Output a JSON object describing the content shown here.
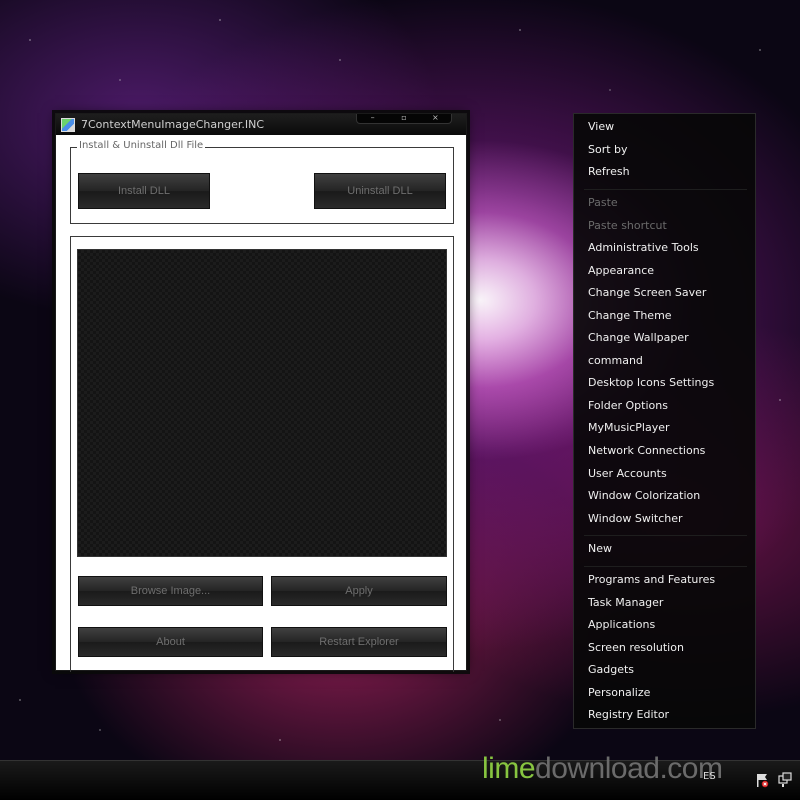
{
  "window": {
    "title": "7ContextMenuImageChanger.INC",
    "controls": {
      "minimize": "–",
      "maximize": "▫",
      "close": "×"
    }
  },
  "install_group": {
    "legend": "Install & Uninstall Dll File",
    "install_button": "Install DLL",
    "uninstall_button": "Uninstall DLL"
  },
  "actions": {
    "browse_button": "Browse Image...",
    "apply_button": "Apply",
    "about_button": "About",
    "restart_button": "Restart Explorer"
  },
  "context_menu": {
    "items": [
      {
        "label": "View",
        "disabled": false
      },
      {
        "label": "Sort by",
        "disabled": false
      },
      {
        "label": "Refresh",
        "disabled": false
      },
      {
        "label": "Paste",
        "disabled": true
      },
      {
        "label": "Paste shortcut",
        "disabled": true
      },
      {
        "label": "Administrative Tools",
        "disabled": false
      },
      {
        "label": "Appearance",
        "disabled": false
      },
      {
        "label": "Change Screen Saver",
        "disabled": false
      },
      {
        "label": "Change Theme",
        "disabled": false
      },
      {
        "label": "Change Wallpaper",
        "disabled": false
      },
      {
        "label": "command",
        "disabled": false
      },
      {
        "label": "Desktop Icons Settings",
        "disabled": false
      },
      {
        "label": "Folder Options",
        "disabled": false
      },
      {
        "label": "MyMusicPlayer",
        "disabled": false
      },
      {
        "label": "Network Connections",
        "disabled": false
      },
      {
        "label": "User Accounts",
        "disabled": false
      },
      {
        "label": "Window Colorization",
        "disabled": false
      },
      {
        "label": "Window Switcher",
        "disabled": false
      },
      {
        "label": "New",
        "disabled": false
      },
      {
        "label": "Programs and Features",
        "disabled": false
      },
      {
        "label": "Task Manager",
        "disabled": false
      },
      {
        "label": "Applications",
        "disabled": false
      },
      {
        "label": "Screen resolution",
        "disabled": false
      },
      {
        "label": "Gadgets",
        "disabled": false
      },
      {
        "label": "Personalize",
        "disabled": false
      },
      {
        "label": "Registry Editor",
        "disabled": false
      }
    ]
  },
  "taskbar": {
    "language": "ES",
    "watermark_lime": "lime",
    "watermark_rest": "download.com"
  },
  "colors": {
    "menu_text": "#f0f0f0",
    "menu_disabled": "#6b6b6b",
    "button_text": "#6e6e6e",
    "watermark_green": "#87c540"
  }
}
